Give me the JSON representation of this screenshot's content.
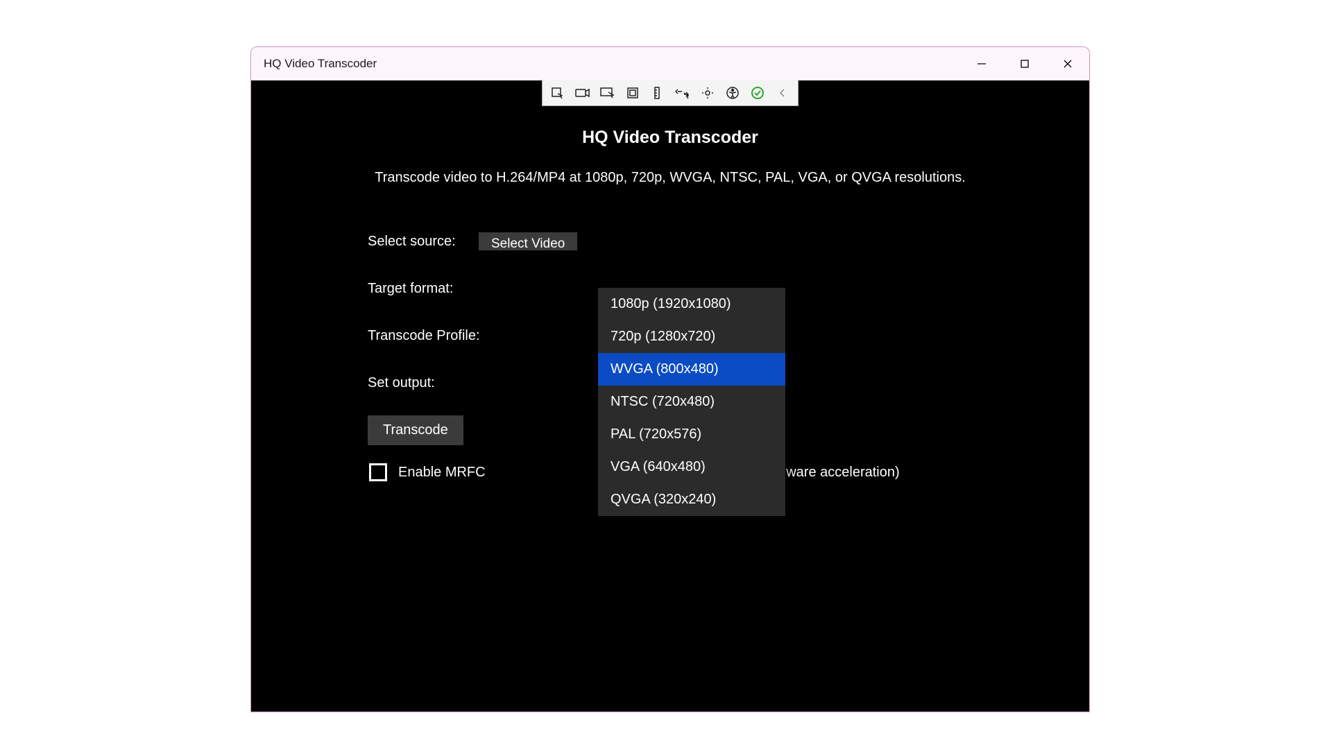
{
  "window": {
    "title": "HQ Video Transcoder"
  },
  "app": {
    "heading": "HQ Video Transcoder",
    "subtitle": "Transcode video to H.264/MP4 at 1080p, 720p, WVGA, NTSC, PAL, VGA, or QVGA resolutions."
  },
  "form": {
    "select_source_label": "Select source:",
    "select_video_button": "Select Video",
    "target_format_label": "Target format:",
    "transcode_profile_label": "Transcode Profile:",
    "set_output_label": "Set output:",
    "transcode_button": "Transcode",
    "checkbox_label_left": "Enable MRFC",
    "checkbox_label_right": "rithm (disables hardware acceleration)"
  },
  "dropdown": {
    "options": [
      "1080p (1920x1080)",
      "720p (1280x720)",
      "WVGA (800x480)",
      "NTSC (720x480)",
      "PAL (720x576)",
      "VGA (640x480)",
      "QVGA (320x240)"
    ],
    "selected_index": 2
  }
}
